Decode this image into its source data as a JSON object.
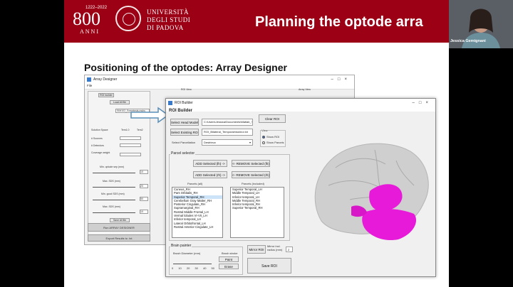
{
  "header": {
    "logo_number": "800",
    "logo_years": "1222–2022",
    "logo_anni": "ANNI",
    "university_lines": [
      "UNIVERSITÀ",
      "DEGLI STUDI",
      "DI PADOVA"
    ],
    "slide_title": "Planning the optode arra"
  },
  "section_title": "Positioning of the optodes: Array Designer",
  "array_designer": {
    "window_title": "Array Designer",
    "menu": [
      "File"
    ],
    "panel_roi": "ROI builder",
    "panel_roi_view": "ROI View",
    "panel_array_view": "Array View",
    "load_all_label": "Load All file",
    "save_all_label": "Save All file",
    "run_label": "Run ARRAY DESIGNER",
    "export_label": "Export Results to .txt",
    "small_labels": [
      "Solution Space",
      "# Sources",
      "# Detectors",
      "Coverage weight",
      "Min. optode sep (mm)",
      "Max. SDS (mm)",
      "Min. good SDS (mm)",
      "Max. SDS (mm)"
    ],
    "head_model_value": "SIM102_Sometests.mshs",
    "radio": [
      "Tem1.0",
      "Tem2"
    ],
    "values": [
      "10",
      "20",
      "50",
      "10"
    ]
  },
  "roi_builder": {
    "window_title": "ROI Builder",
    "heading": "ROI Builder",
    "select_head_model": "Select Head Model",
    "head_model_path": "C:\\Users\\Jessica\\Documents\\Matlab_Toolbox...",
    "select_existing_roi": "Select Existing ROI",
    "existing_roi_path": "ROI_Bilateral_Temporalmsshroi.txt",
    "select_parcellation": "Select Parcellation",
    "parcellation_value": "Destrieux",
    "clear_roi": "Clear ROI",
    "view_label": "View",
    "view_options": [
      "Show ROI",
      "Show Parcels"
    ],
    "parcel_selector_label": "Parcel selector",
    "add_selected_lh": "ADD Selected (lh) ->",
    "remove_selected_lh": "<- REMOVE Selected (lh)",
    "add_selected_rh": "ADD Selected (rh) ->",
    "remove_selected_rh": "<- REMOVE Selected (rh)",
    "parcels_all_label": "Parcels (all)",
    "parcels_included_label": "Parcels (included)",
    "parcels_all": [
      "Cuneus_RH",
      "Pars Orbitalis_RH",
      "Superior Temporal_RH",
      "Cerebellum Gray Matter_RH",
      "Posterior Cingulate_RH",
      "Supramarginal_RH",
      "Rostral Middle Frontal_LH",
      "Vermal lobules VI-VII_LH",
      "Inferior temporal_LH",
      "Lateral Orbitofrontal_LH",
      "Rostral Anterior Cingulate_LH"
    ],
    "parcels_all_selected": "Superior Temporal_RH",
    "parcels_included": [
      "Superior Temporal_LH",
      "Middle Temporal_LH",
      "Inferior temporal_LH",
      "Middle Temporal_RH",
      "Inferior temporal_RH",
      "Superior Temporal_RH"
    ],
    "brain_painter_label": "Brain painter",
    "brush_diameter_label": "Brush Diameter (mm)",
    "brush_stroke_label": "Brush stroke",
    "paint_label": "Paint",
    "erase_label": "Erase",
    "brush_ticks": [
      "0",
      "10",
      "20",
      "30",
      "40",
      "50"
    ],
    "mirror_roi": "Mirror ROI",
    "mirror_incl_label": "Mirror incl. radius (mm)",
    "mirror_incl_value": "2",
    "save_roi": "Save ROI"
  },
  "webcam": {
    "name": "Jessica Gemignani"
  },
  "colors": {
    "header_red": "#9b0014",
    "roi_magenta": "#e81ad9",
    "brain_gray": "#cfcfcf"
  }
}
